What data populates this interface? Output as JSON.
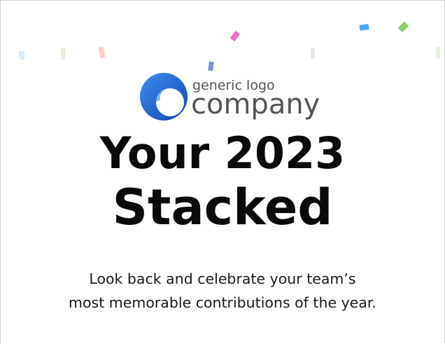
{
  "logo": {
    "icon": "company-logo-icon",
    "tagline": "generic logo",
    "name": "company",
    "colors": {
      "mark_outer": "#1f5fc4",
      "mark_inner": "#3fa9f5",
      "text": "#555555"
    }
  },
  "hero": {
    "title_line1": "Your 2023",
    "title_line2": "Stacked",
    "subtitle_line1": "Look back and celebrate your team’s",
    "subtitle_line2": "most memorable contributions of the year."
  },
  "decor": {
    "confetti_colors": [
      "#f06bc0",
      "#4aa8f0",
      "#8ed06a",
      "#7a96d6",
      "#f5b0a0",
      "#cfe6f5",
      "#d8ecd0",
      "#e6e6e6"
    ]
  }
}
